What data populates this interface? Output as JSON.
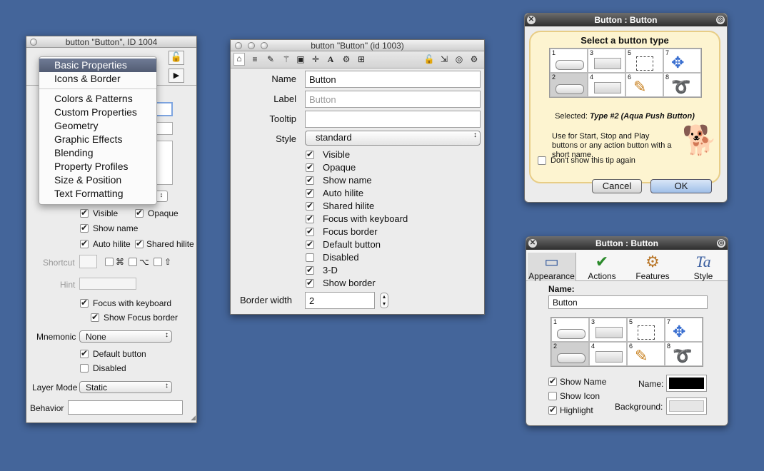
{
  "win1": {
    "title": "button \"Button\", ID 1004",
    "menu": {
      "items": [
        "Basic Properties",
        "Icons & Border",
        "Colors & Patterns",
        "Custom Properties",
        "Geometry",
        "Graphic Effects",
        "Blending",
        "Property Profiles",
        "Size & Position",
        "Text Formatting"
      ]
    },
    "cb": {
      "visible": "Visible",
      "opaque": "Opaque",
      "show_name": "Show name",
      "auto_hilite": "Auto hilite",
      "shared_hilite": "Shared hilite",
      "focus_kb": "Focus with keyboard",
      "show_focus": "Show Focus border",
      "default_btn": "Default button",
      "disabled": "Disabled"
    },
    "shortcut_label": "Shortcut",
    "cmd": "⌘",
    "opt": "⌥",
    "shift": "⇧",
    "hint_label": "Hint",
    "mnemonic_label": "Mnemonic",
    "mnemonic_value": "None",
    "layer_label": "Layer Mode",
    "layer_value": "Static",
    "behavior_label": "Behavior"
  },
  "win2": {
    "title": "button \"Button\" (id 1003)",
    "name_label": "Name",
    "name_value": "Button",
    "label_label": "Label",
    "label_placeholder": "Button",
    "tooltip_label": "Tooltip",
    "style_label": "Style",
    "style_value": "standard",
    "checks": [
      {
        "label": "Visible",
        "on": true
      },
      {
        "label": "Opaque",
        "on": true
      },
      {
        "label": "Show name",
        "on": true
      },
      {
        "label": "Auto hilite",
        "on": true
      },
      {
        "label": "Shared hilite",
        "on": true
      },
      {
        "label": "Focus with keyboard",
        "on": true
      },
      {
        "label": "Focus border",
        "on": true
      },
      {
        "label": "Default button",
        "on": true
      },
      {
        "label": "Disabled",
        "on": false
      },
      {
        "label": "3-D",
        "on": true
      },
      {
        "label": "Show border",
        "on": true
      }
    ],
    "border_label": "Border width",
    "border_value": "2"
  },
  "win3": {
    "title": "Button : Button",
    "heading": "Select a button type",
    "nums": [
      "1",
      "3",
      "5",
      "7",
      "2",
      "4",
      "6",
      "8"
    ],
    "selected_prefix": "Selected: ",
    "selected_value": "Type #2 (Aqua Push Button)",
    "desc": "Use for Start, Stop and Play buttons or any action button with a short name.",
    "dont_show": "Don't show this tip again",
    "cancel": "Cancel",
    "ok": "OK"
  },
  "win4": {
    "title": "Button : Button",
    "tabs": [
      "Appearance",
      "Actions",
      "Features",
      "Style"
    ],
    "name_label": "Name:",
    "name_value": "Button",
    "nums": [
      "1",
      "3",
      "5",
      "7",
      "2",
      "4",
      "6",
      "8"
    ],
    "show_name": "Show Name",
    "show_icon": "Show Icon",
    "highlight": "Highlight",
    "name_color_label": "Name:",
    "bg_label": "Background:",
    "colors": {
      "name": "#000000",
      "background": "#e6e6e6"
    }
  }
}
